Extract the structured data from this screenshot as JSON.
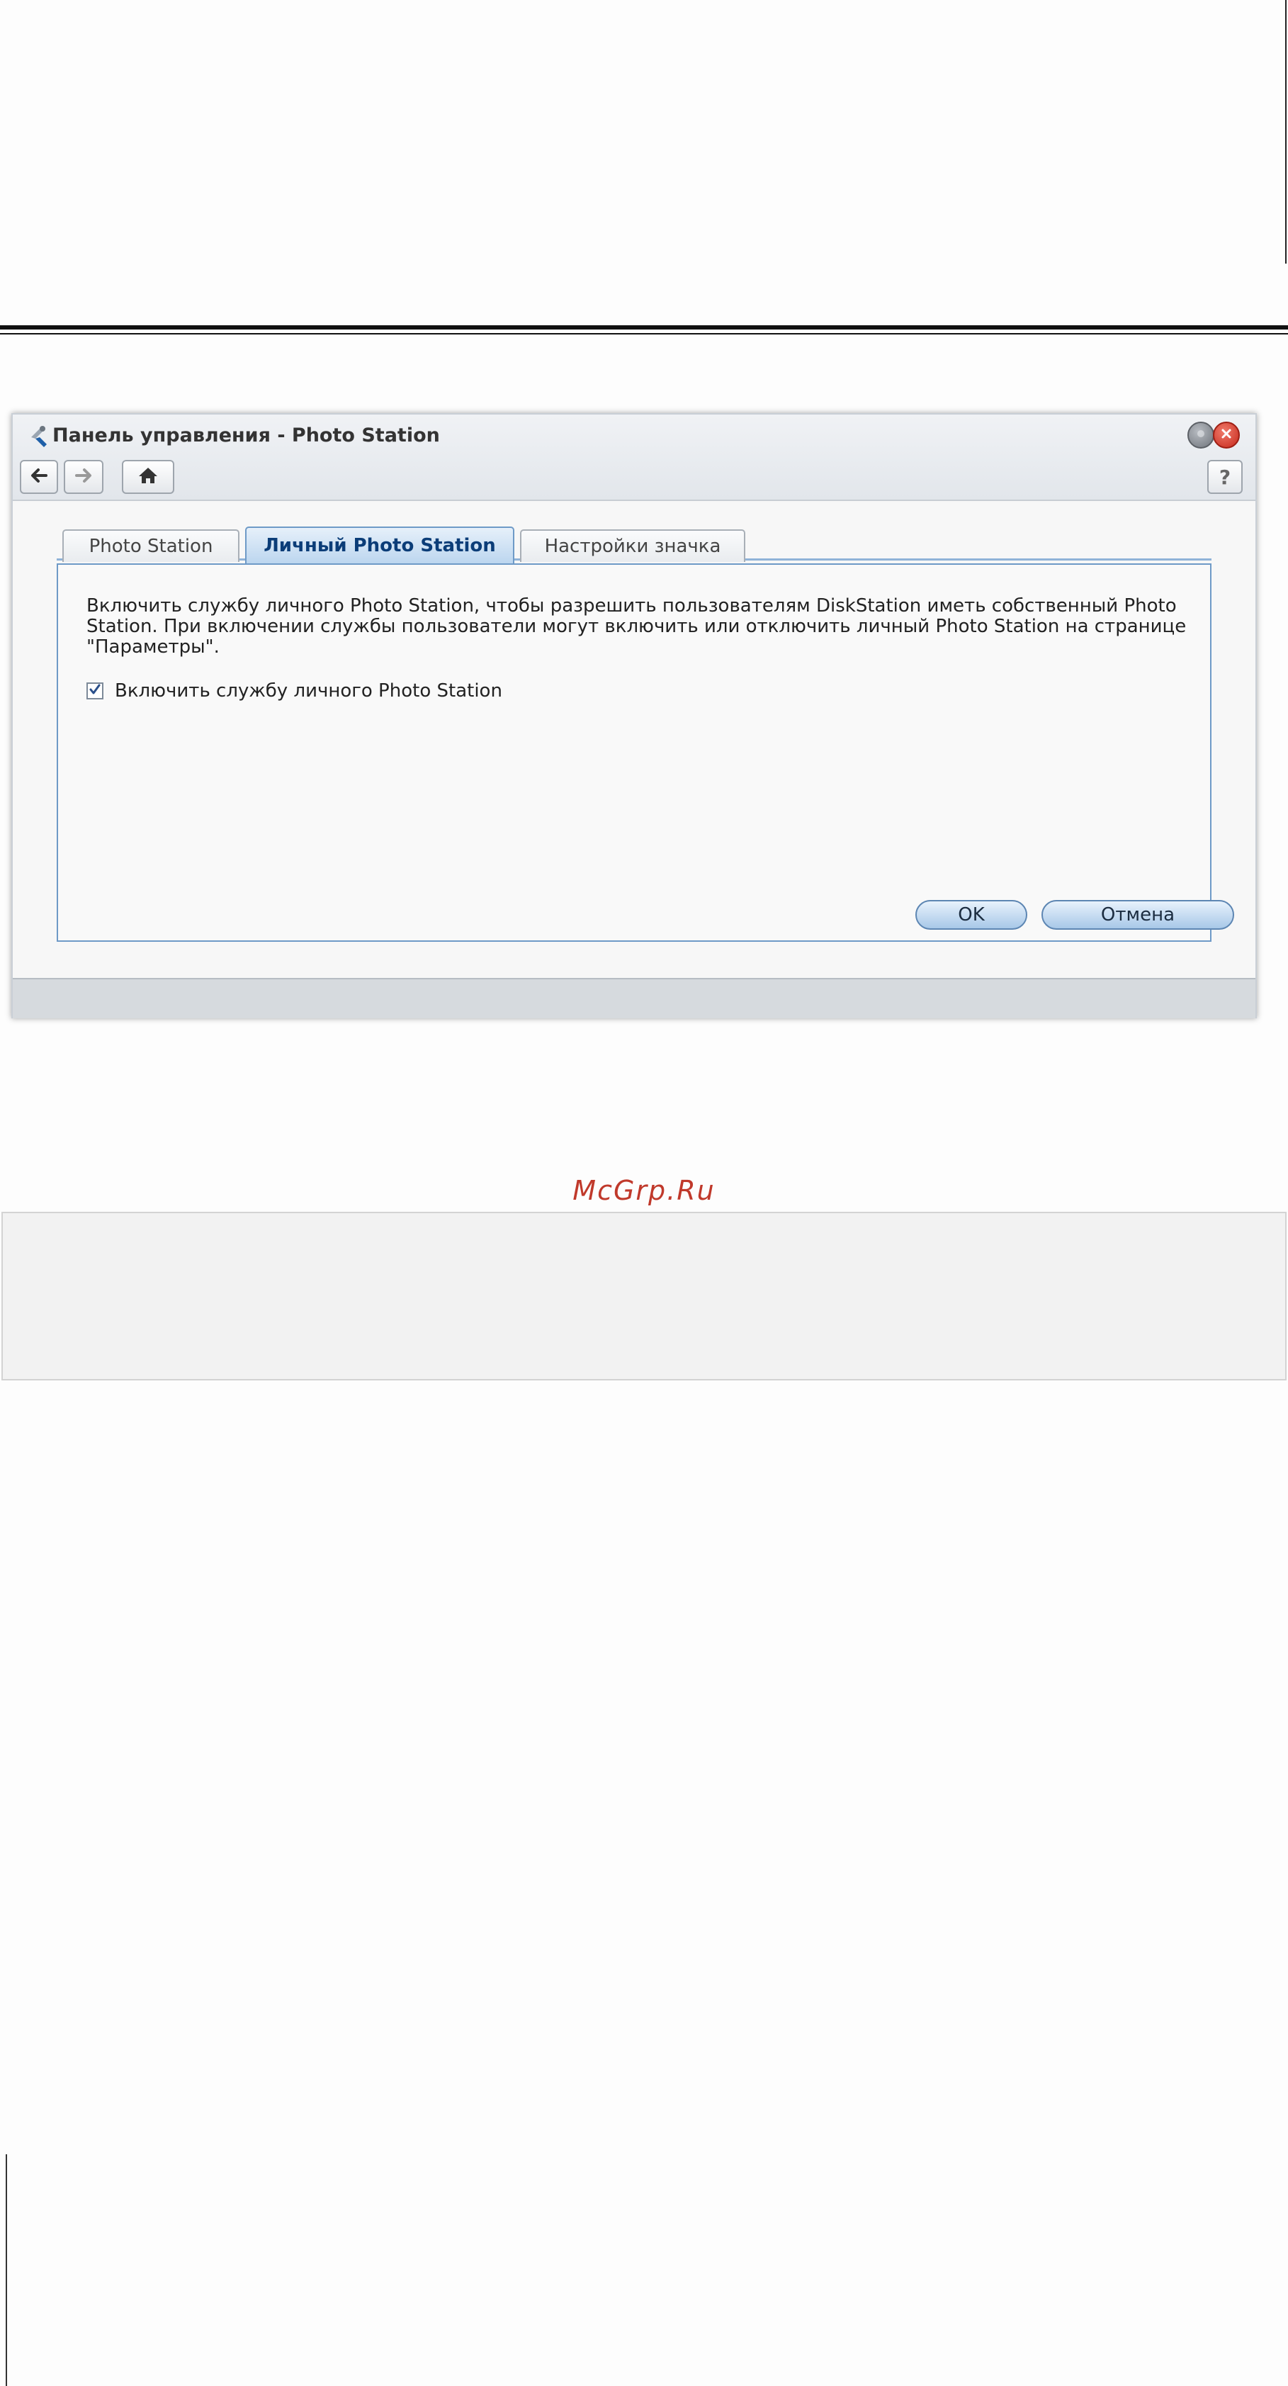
{
  "window": {
    "title": "Панель управления - Photo Station",
    "help_label": "?"
  },
  "tabs": [
    {
      "label": "Photo Station",
      "active": false
    },
    {
      "label": "Личный Photo Station",
      "active": true
    },
    {
      "label": "Настройки значка",
      "active": false
    }
  ],
  "content": {
    "description": "Включить службу личного Photo Station, чтобы разрешить пользователям DiskStation иметь собственный Photo Station. При включении службы пользователи могут включить или отключить личный Photo Station на странице \"Параметры\".",
    "checkbox_label": "Включить службу личного Photo Station",
    "checkbox_checked": true
  },
  "buttons": {
    "ok": "OK",
    "cancel": "Отмена"
  },
  "watermark": "McGrp.Ru",
  "icons": {
    "app": "control-panel-icon",
    "back": "arrow-left-icon",
    "forward": "arrow-right-icon",
    "home": "home-icon",
    "minimize": "minimize-icon",
    "close": "close-icon",
    "check": "checkmark-icon"
  },
  "colors": {
    "accent": "#6e9ac7",
    "active_tab_text": "#0b3d78",
    "watermark": "#c0392b",
    "close_button": "#c6281b"
  }
}
